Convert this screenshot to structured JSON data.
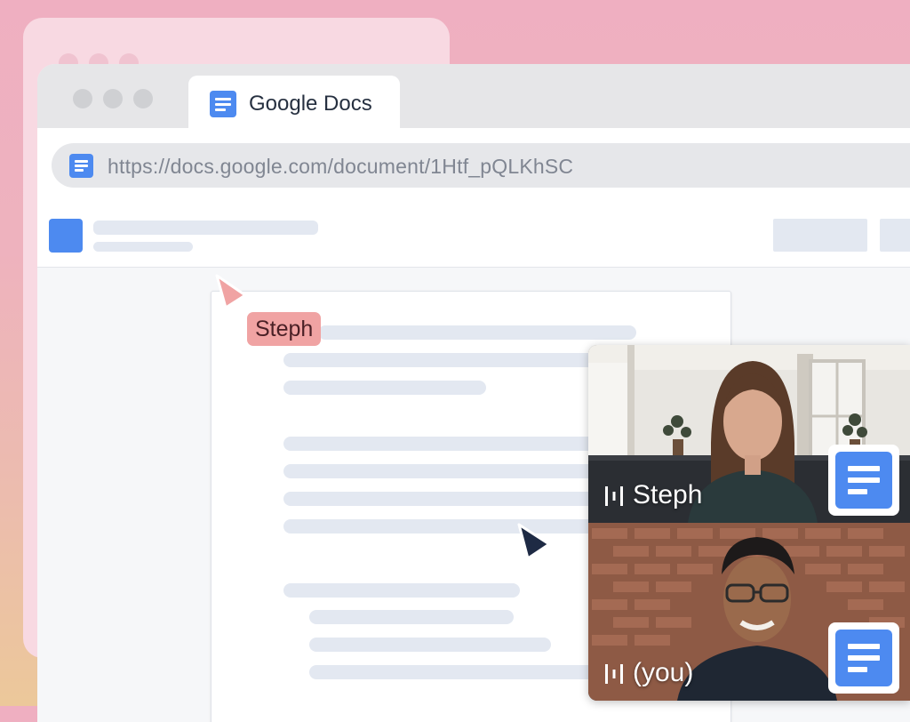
{
  "browser": {
    "tab_title": "Google Docs",
    "url": "https://docs.google.com/document/1Htf_pQLKhSC"
  },
  "collaborator": {
    "name": "Steph",
    "cursor_color": "#f0a3a3",
    "own_cursor_color": "#1e2a44"
  },
  "video": {
    "participants": [
      {
        "label": "Steph"
      },
      {
        "label": "(you)"
      }
    ]
  },
  "colors": {
    "docs_blue": "#4d8af0",
    "skeleton": "#e3e8f1"
  }
}
